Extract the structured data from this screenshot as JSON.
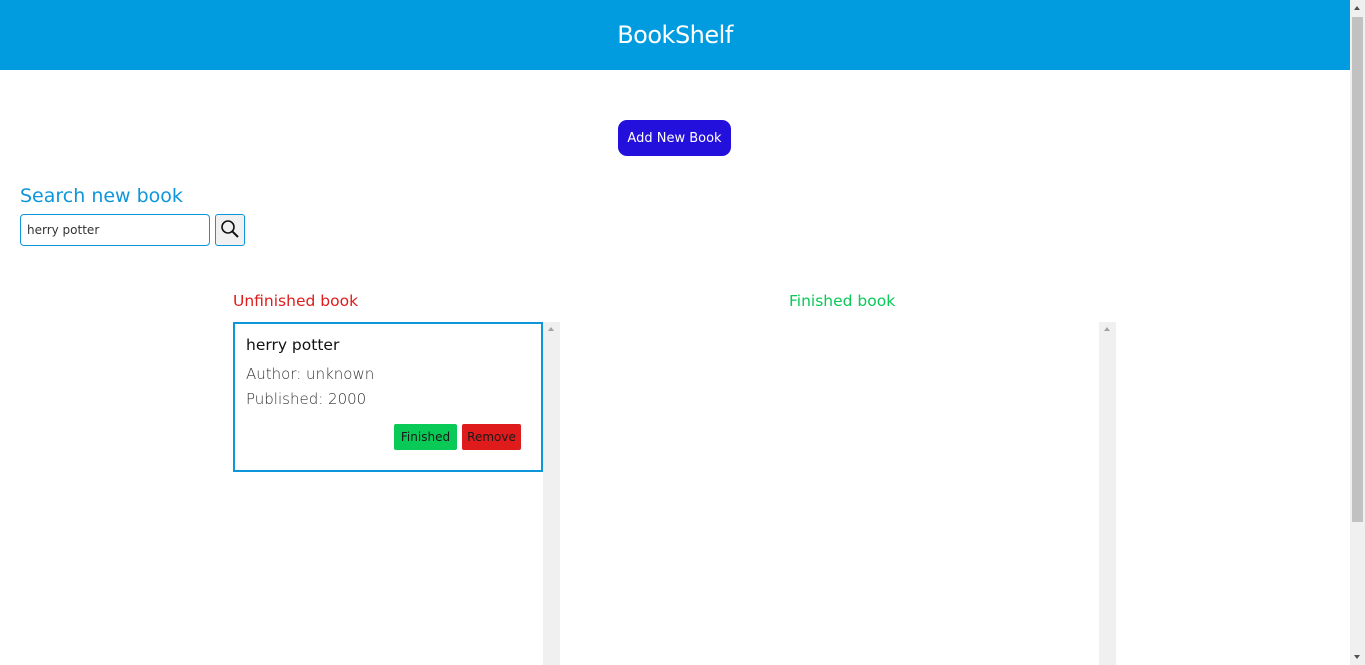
{
  "header": {
    "title": "BookShelf"
  },
  "actions": {
    "add_book_label": "Add New Book"
  },
  "search": {
    "title": "Search new book",
    "value": "herry potter",
    "button_icon": "search-icon"
  },
  "columns": {
    "unfinished": {
      "title": "Unfinished book",
      "books": [
        {
          "title": "herry potter",
          "author": "Author: unknown",
          "published": "Published: 2000",
          "finished_label": "Finished",
          "remove_label": "Remove"
        }
      ]
    },
    "finished": {
      "title": "Finished book",
      "books": []
    }
  },
  "colors": {
    "header_bg": "#009cdf",
    "add_button": "#2410dc",
    "search_title": "#0d96da",
    "unfinished": "#e01b1b",
    "finished": "#09c957"
  }
}
